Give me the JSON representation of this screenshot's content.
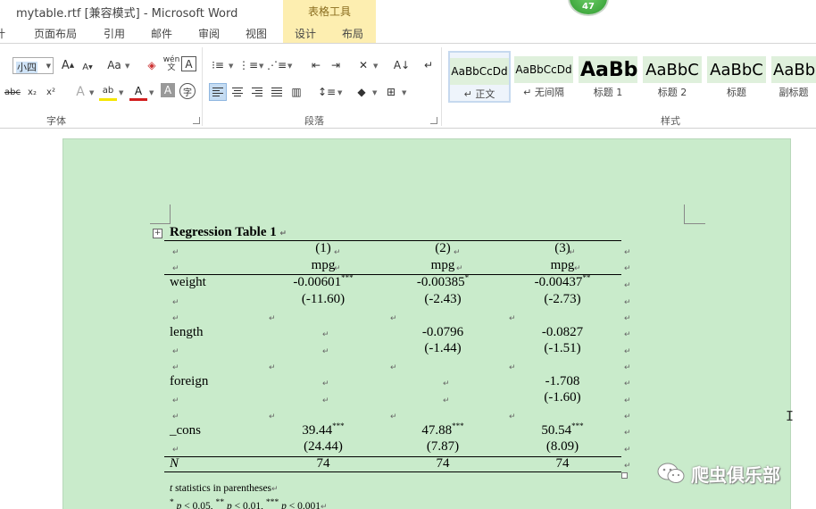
{
  "window": {
    "title": "mytable.rtf [兼容模式] - Microsoft Word"
  },
  "contextual": {
    "label": "表格工具"
  },
  "notification": {
    "count": "47"
  },
  "tabs": [
    {
      "label": "计"
    },
    {
      "label": "页面布局"
    },
    {
      "label": "引用"
    },
    {
      "label": "邮件"
    },
    {
      "label": "审阅"
    },
    {
      "label": "视图"
    },
    {
      "label": "设计"
    },
    {
      "label": "布局"
    }
  ],
  "ribbon": {
    "font": {
      "size_value": "小四",
      "group_label": "字体",
      "grow_label": "A",
      "shrink_label": "A",
      "case_label": "Aa",
      "phonetic_label": "wén",
      "border_char_label": "A",
      "strike_label": "abc",
      "sub_label": "x₂",
      "sup_label": "x²",
      "effect_label": "A",
      "highlight_label": "ab",
      "color_label": "A",
      "shade_label": "A",
      "enclose_label": "字"
    },
    "paragraph": {
      "group_label": "段落"
    },
    "styles": {
      "group_label": "样式",
      "items": [
        {
          "sample": "AaBbCcDd",
          "name": "↵ 正文"
        },
        {
          "sample": "AaBbCcDd",
          "name": "↵ 无间隔"
        },
        {
          "sample": "AaBb",
          "name": "标题 1"
        },
        {
          "sample": "AaBbC",
          "name": "标题 2"
        },
        {
          "sample": "AaBbC",
          "name": "标题"
        },
        {
          "sample": "AaBb",
          "name": "副标题"
        }
      ]
    }
  },
  "document": {
    "table_title": "Regression Table 1",
    "columns": [
      {
        "num": "(1)",
        "dep": "mpg"
      },
      {
        "num": "(2)",
        "dep": "mpg"
      },
      {
        "num": "(3)",
        "dep": "mpg"
      }
    ],
    "rows": {
      "weight": {
        "label": "weight",
        "c1": "-0.00601",
        "c1s": "***",
        "c2": "-0.00385",
        "c2s": "*",
        "c3": "-0.00437",
        "c3s": "**",
        "t1": "(-11.60)",
        "t2": "(-2.43)",
        "t3": "(-2.73)"
      },
      "length": {
        "label": "length",
        "c2": "-0.0796",
        "c3": "-0.0827",
        "t2": "(-1.44)",
        "t3": "(-1.51)"
      },
      "foreign": {
        "label": "foreign",
        "c3": "-1.708",
        "t3": "(-1.60)"
      },
      "cons": {
        "label": "_cons",
        "c1": "39.44",
        "c1s": "***",
        "c2": "47.88",
        "c2s": "***",
        "c3": "50.54",
        "c3s": "***",
        "t1": "(24.44)",
        "t2": "(7.87)",
        "t3": "(8.09)"
      },
      "n": {
        "label": "N",
        "c1": "74",
        "c2": "74",
        "c3": "74"
      }
    },
    "notes": {
      "line1_t": "t",
      "line1_rest": " statistics in parentheses",
      "s1": "*",
      "p1": " p",
      "lt1": " < 0.05, ",
      "s2": "**",
      "p2": " p",
      "lt2": " < 0.01, ",
      "s3": "***",
      "p3": " p",
      "lt3": " < 0.001"
    },
    "para_mark": "↵"
  },
  "watermark": {
    "text": "爬虫俱乐部"
  },
  "colors": {
    "page_bg": "#c9ebcb",
    "ribbon_bg": "#ffffff",
    "contextual_bg": "#fdeeb0",
    "accent_selection": "#c5dcf2"
  }
}
